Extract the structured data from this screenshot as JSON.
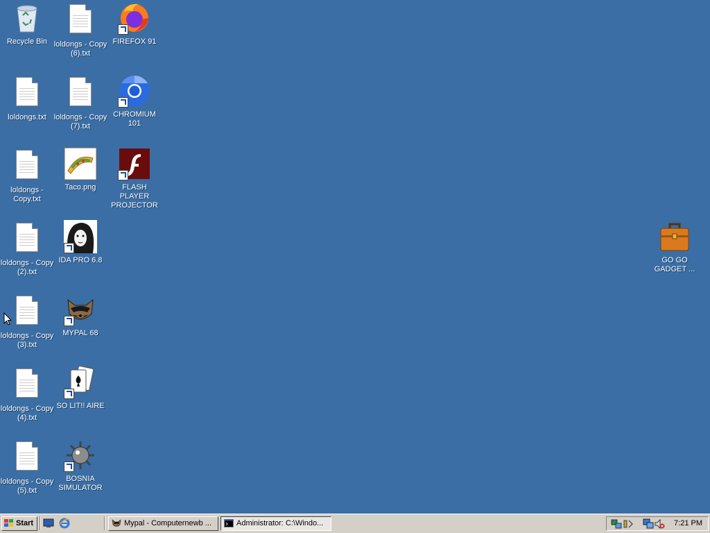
{
  "desktop": {
    "background": "#3a6ea5",
    "icons": [
      {
        "label": "Recycle Bin",
        "icon": "recycle-bin-icon"
      },
      {
        "label": "loldongs - Copy (6).txt",
        "icon": "text-file-icon"
      },
      {
        "label": "FIREFOX 91",
        "icon": "firefox-icon"
      },
      {
        "label": "loldongs.txt",
        "icon": "text-file-icon"
      },
      {
        "label": "loldongs - Copy (7).txt",
        "icon": "text-file-icon"
      },
      {
        "label": "CHROMIUM 101",
        "icon": "chromium-icon"
      },
      {
        "label": "loldongs - Copy.txt",
        "icon": "text-file-icon"
      },
      {
        "label": "Taco.png",
        "icon": "taco-image-icon"
      },
      {
        "label": "FLASH PLAYER PROJECTOR",
        "icon": "flash-player-icon"
      },
      {
        "label": "loldongs - Copy (2).txt",
        "icon": "text-file-icon"
      },
      {
        "label": "IDA PRO 6.8",
        "icon": "ida-pro-icon"
      },
      {
        "label": "loldongs - Copy (3).txt",
        "icon": "text-file-icon"
      },
      {
        "label": "MYPAL 68",
        "icon": "mypal-icon"
      },
      {
        "label": "loldongs - Copy (4).txt",
        "icon": "text-file-icon"
      },
      {
        "label": "SO LIT!! AIRE",
        "icon": "solitaire-icon"
      },
      {
        "label": "loldongs - Copy (5).txt",
        "icon": "text-file-icon"
      },
      {
        "label": "BOSNIA SIMULATOR",
        "icon": "minesweeper-icon"
      },
      {
        "label": "GO GO GADGET ...",
        "icon": "briefcase-icon"
      }
    ]
  },
  "taskbar": {
    "start_label": "Start",
    "quicklaunch": [
      "show-desktop-icon",
      "internet-explorer-icon"
    ],
    "windows": [
      {
        "label": "Mypal - Computernewb ...",
        "icon": "mypal-icon",
        "active": false
      },
      {
        "label": "Administrator: C:\\Windo...",
        "icon": "cmd-icon",
        "active": true
      }
    ],
    "tray_icons": [
      "network-icon",
      "volume-icon",
      "network-connection-icon",
      "speaker-muted-icon"
    ],
    "clock": "7:21 PM"
  }
}
